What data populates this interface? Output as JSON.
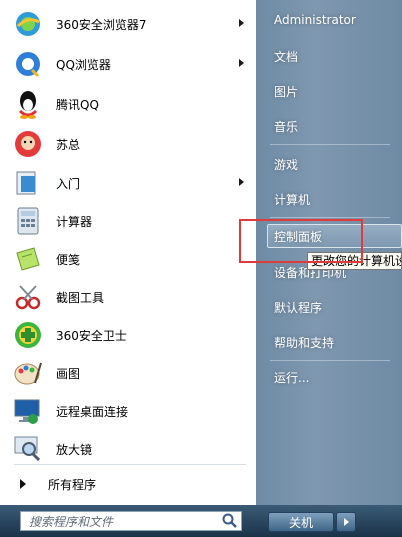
{
  "programs": [
    {
      "label": "360安全浏览器7",
      "icon": "360-browser-icon",
      "arrow": true
    },
    {
      "label": "QQ浏览器",
      "icon": "qq-browser-icon",
      "arrow": true
    },
    {
      "label": "腾讯QQ",
      "icon": "qq-penguin-icon",
      "arrow": false
    },
    {
      "label": "苏总",
      "icon": "avatar-icon",
      "arrow": false
    },
    {
      "label": "入门",
      "icon": "getting-started-icon",
      "arrow": true
    },
    {
      "label": "计算器",
      "icon": "calculator-icon",
      "arrow": false
    },
    {
      "label": "便笺",
      "icon": "sticky-notes-icon",
      "arrow": false
    },
    {
      "label": "截图工具",
      "icon": "snipping-tool-icon",
      "arrow": false
    },
    {
      "label": "360安全卫士",
      "icon": "360-safe-icon",
      "arrow": false
    },
    {
      "label": "画图",
      "icon": "paint-icon",
      "arrow": false
    },
    {
      "label": "远程桌面连接",
      "icon": "remote-desktop-icon",
      "arrow": false
    },
    {
      "label": "放大镜",
      "icon": "magnifier-icon",
      "arrow": false
    }
  ],
  "all_programs": "所有程序",
  "search": {
    "placeholder": "搜索程序和文件"
  },
  "right": {
    "user": "Administrator",
    "documents": "文档",
    "pictures": "图片",
    "music": "音乐",
    "games": "游戏",
    "computer": "计算机",
    "control_panel": "控制面板",
    "devices": "设备和打印机",
    "default_programs": "默认程序",
    "help": "帮助和支持",
    "run": "运行..."
  },
  "tooltip": "更改您的计算机设",
  "shutdown": "关机"
}
